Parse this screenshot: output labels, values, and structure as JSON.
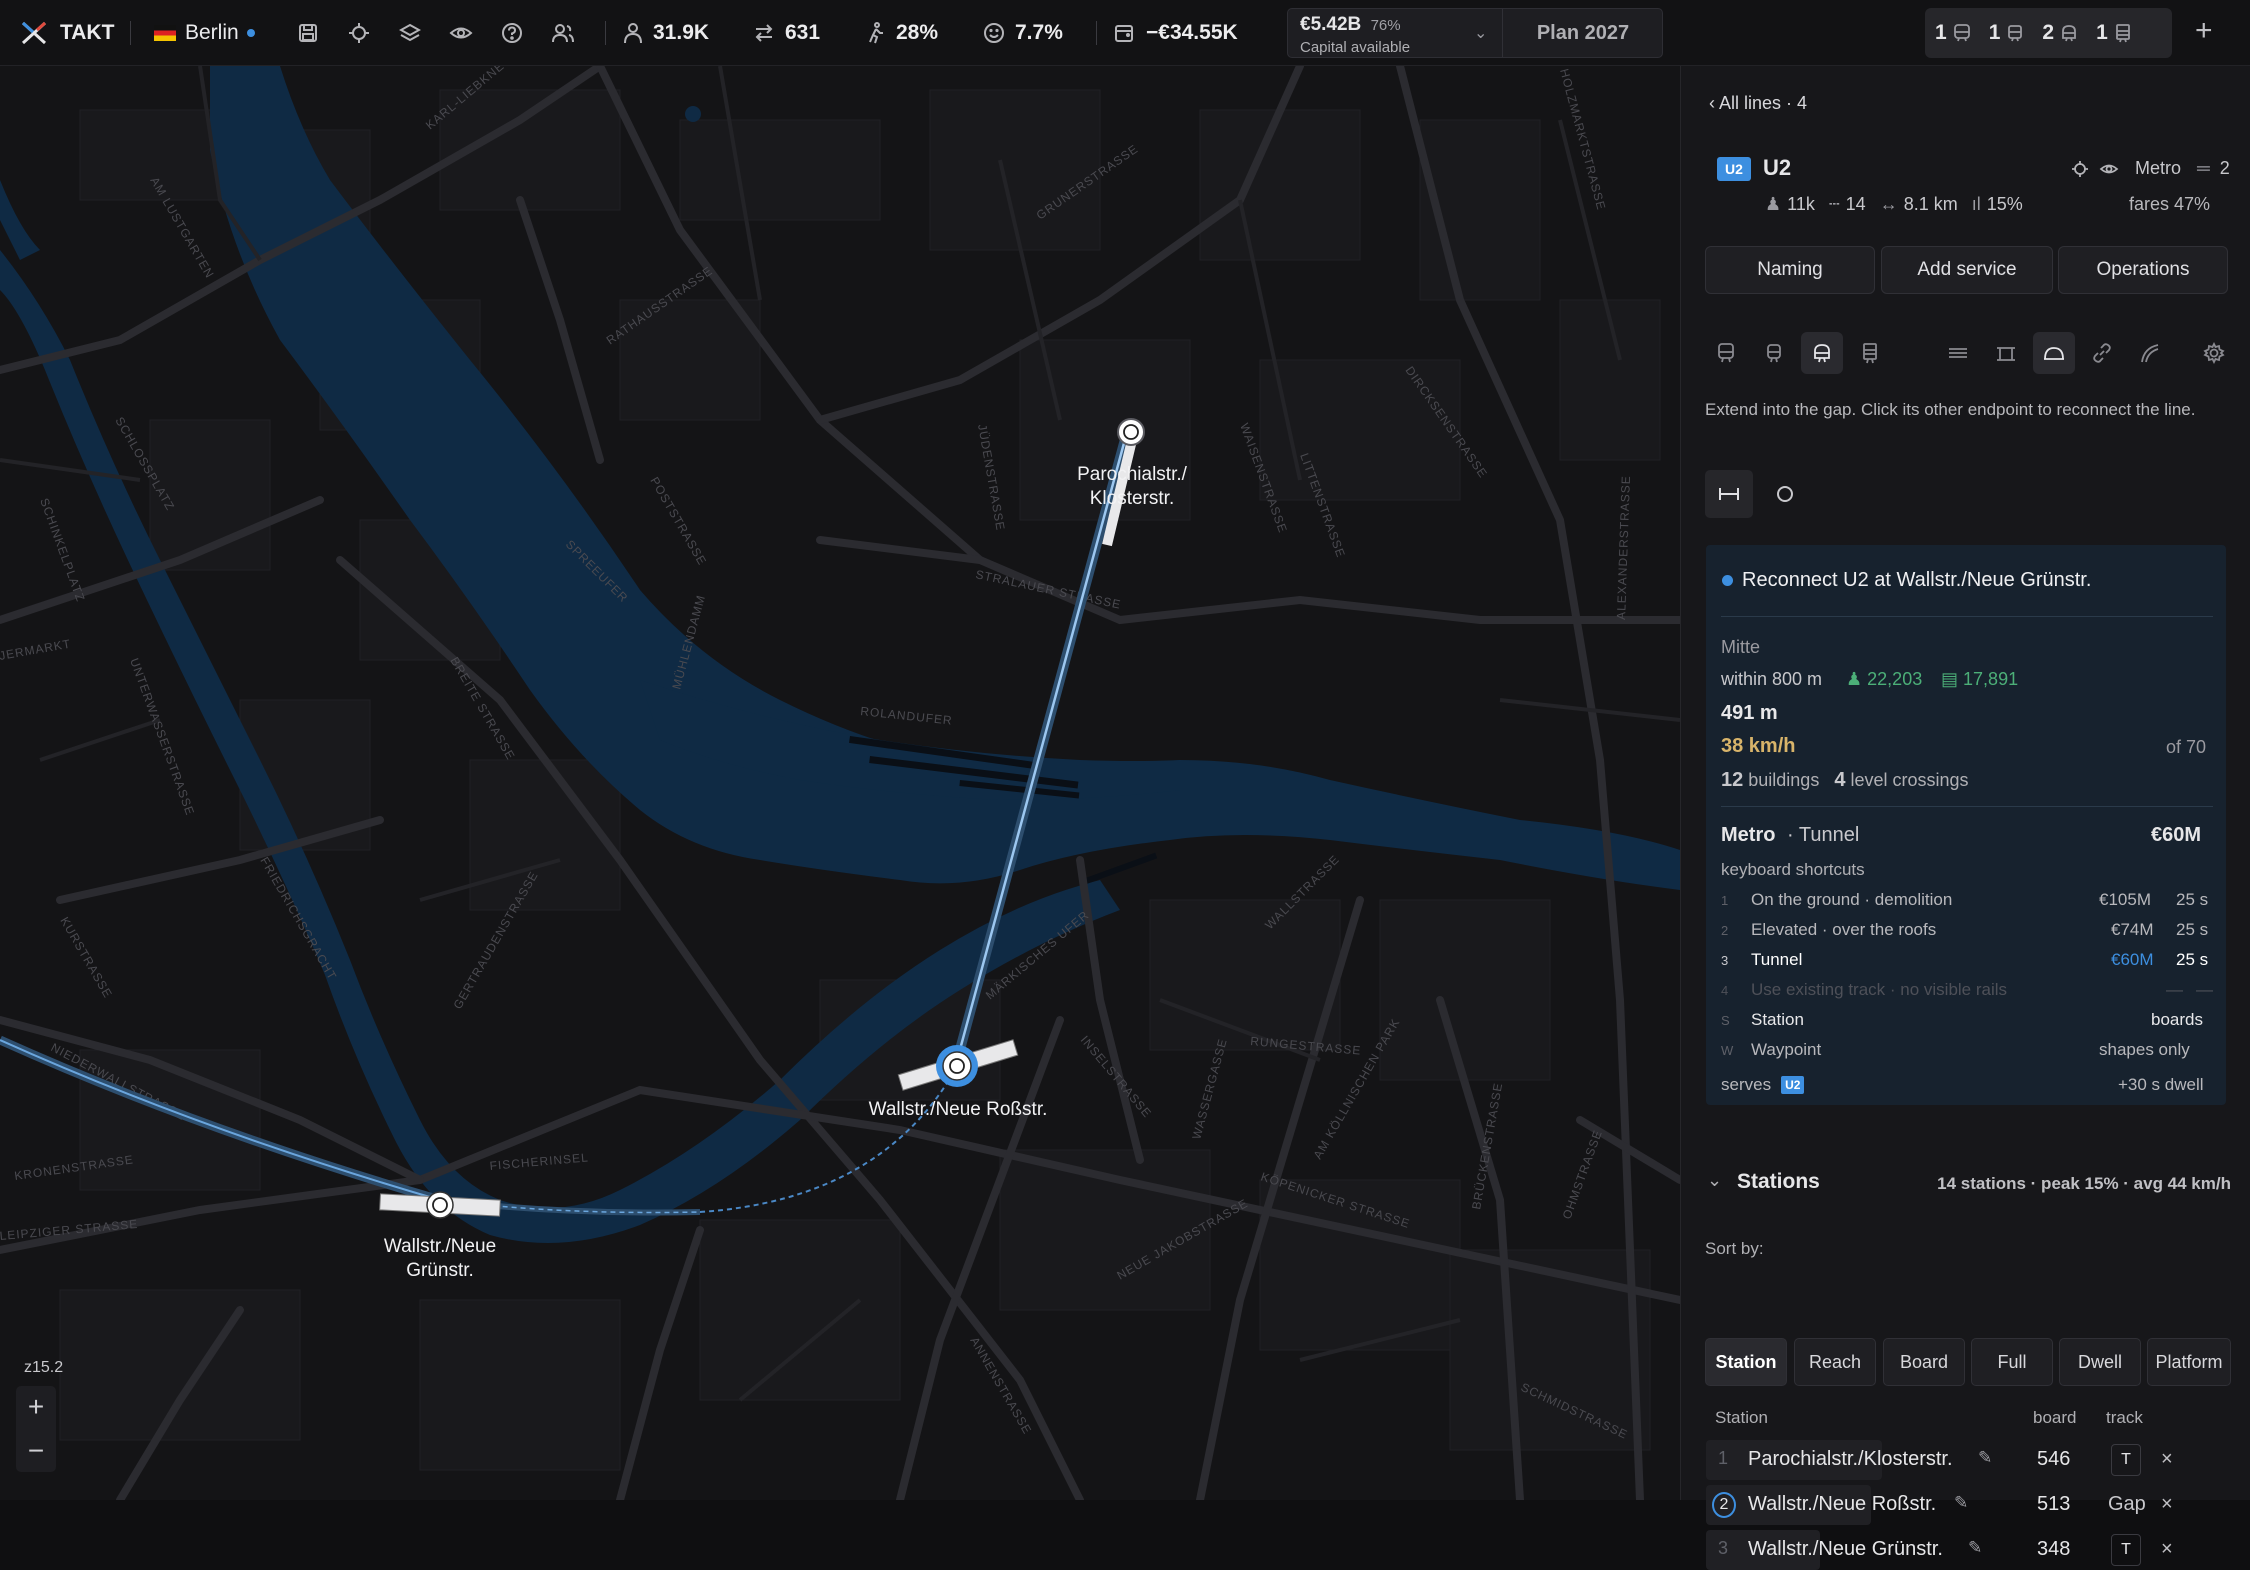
{
  "topbar": {
    "app_name": "TAKT",
    "city": "Berlin",
    "stats": {
      "population": "31.9K",
      "transfers": "631",
      "walk": "28%",
      "satisfaction": "7.7%",
      "balance": "−€34.55K"
    },
    "capital": {
      "amount": "€5.42B",
      "percent": "76%",
      "label": "Capital available"
    },
    "plan": "Plan 2027",
    "vehicle_counts": [
      "1",
      "1",
      "2",
      "1"
    ]
  },
  "map": {
    "zoom": "z15.2",
    "stations": [
      {
        "label_line1": "Parochialstr./",
        "label_line2": "Klosterstr."
      },
      {
        "label_line1": "Wallstr./Neue Roßstr.",
        "label_line2": ""
      },
      {
        "label_line1": "Wallstr./Neue",
        "label_line2": "Grünstr."
      }
    ],
    "streets": [
      "KARL-LIEBKNECHT",
      "AM LUSTGARTEN",
      "RATHAUSSTRASSE",
      "GRUNERSTRASSE",
      "SCHLOSSPLATZ",
      "POSTSTRASSE",
      "SPREEUFER",
      "JÜDENSTRASSE",
      "WAISENSTRASSE",
      "LITTENSTRASSE",
      "DIRCKSENSTRASSE",
      "STRALAUER STRASSE",
      "ROLANDUFER",
      "MÜHLENDAMM",
      "BREITE STRASSE",
      "UNTERWASSERSTRASSE",
      "FRIEDRICHSGRACHT",
      "GERTRAUDENSTRASSE",
      "WALLSTRASSE",
      "MÄRKISCHES UFER",
      "INSELSTRASSE",
      "RUNGESTRASSE",
      "WASSERGASSE",
      "AM KÖLLNISCHEN PARK",
      "BRÜCKENSTRASSE",
      "KÖPENICKER STRASSE",
      "NEUE JAKOBSTRASSE",
      "FISCHERINSEL",
      "KRONENSTRASSE",
      "LEIPZIGER STRASSE",
      "ANNENSTRASSE",
      "SCHMIDSTRASSE",
      "OHMSTRASSE",
      "ALEXANDERSTRASSE",
      "KURSTRASSE",
      "NIEDERWALLSTRASSE",
      "SCHINKELPLATZ",
      "JERMARKT",
      "HOLZMARKTSTRASSE"
    ]
  },
  "panel": {
    "back_link": "All lines · 4",
    "line_badge": "U2",
    "line_name": "U2",
    "line_type": "Metro",
    "line_count": "2",
    "stats": {
      "riders": "11k",
      "stations": "14",
      "length": "8.1 km",
      "peak": "15%"
    },
    "fares": "fares 47%",
    "buttons": [
      "Naming",
      "Add service",
      "Operations"
    ],
    "hint": "Extend into the gap. Click its other endpoint to reconnect the line.",
    "card": {
      "title": "Reconnect U2 at Wallstr./Neue Grünstr.",
      "district": "Mitte",
      "within": "within 800 m",
      "population": "22,203",
      "jobs": "17,891",
      "distance": "491 m",
      "speed": "38 km/h",
      "speed_of": "of 70",
      "buildings_count": "12",
      "buildings_label": "buildings",
      "crossings_count": "4",
      "crossings_label": "level crossings",
      "mode": "Metro",
      "mode_sub": "· Tunnel",
      "cost": "€60M",
      "shortcuts_title": "keyboard shortcuts",
      "shortcuts": [
        {
          "key": "1",
          "label": "On the ground · demolition",
          "cost": "€105M",
          "time": "25 s"
        },
        {
          "key": "2",
          "label": "Elevated · over the roofs",
          "cost": "€74M",
          "time": "25 s"
        },
        {
          "key": "3",
          "label": "Tunnel",
          "cost": "€60M",
          "time": "25 s"
        },
        {
          "key": "4",
          "label": "Use existing track · no visible rails",
          "cost": "—",
          "time": "—"
        },
        {
          "key": "S",
          "label": "Station",
          "cost": "",
          "time": "boards"
        },
        {
          "key": "W",
          "label": "Waypoint",
          "cost": "",
          "time": "shapes only"
        }
      ],
      "serves_label": "serves",
      "serves_badge": "U2",
      "dwell": "+30 s dwell"
    },
    "stations_section": {
      "title": "Stations",
      "summary": "14 stations · peak 15% · avg 44 km/h",
      "sort_label": "Sort by:",
      "sort_options": [
        "Station",
        "Reach",
        "Board",
        "Full",
        "Dwell",
        "Platform"
      ],
      "columns": {
        "station": "Station",
        "board": "board",
        "track": "track"
      },
      "rows": [
        {
          "num": "1",
          "name": "Parochialstr./Klosterstr.",
          "board": "546",
          "track": "T"
        },
        {
          "num": "2",
          "name": "Wallstr./Neue Roßstr.",
          "board": "513",
          "track": "Gap"
        },
        {
          "num": "3",
          "name": "Wallstr./Neue Grünstr.",
          "board": "348",
          "track": "T"
        }
      ]
    }
  },
  "colors": {
    "accent": "#3d8fe0",
    "water": "#0f2a44",
    "green": "#4caf78",
    "speed": "#d8b46a",
    "card_bg": "#17222e"
  }
}
